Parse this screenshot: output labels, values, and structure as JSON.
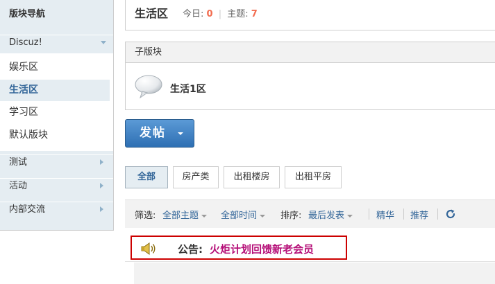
{
  "sidebar": {
    "title": "版块导航",
    "groups": [
      {
        "label": "Discuz!",
        "arrow": "down"
      },
      {
        "label": "测试",
        "arrow": "right"
      },
      {
        "label": "活动",
        "arrow": "right"
      },
      {
        "label": "内部交流",
        "arrow": "right"
      }
    ],
    "forums": [
      {
        "label": "娱乐区",
        "active": false
      },
      {
        "label": "生活区",
        "active": true
      },
      {
        "label": "学习区",
        "active": false
      },
      {
        "label": "默认版块",
        "active": false
      }
    ]
  },
  "header": {
    "title": "生活区",
    "today_label": "今日:",
    "today_count": "0",
    "separator": "|",
    "threads_label": "主题:",
    "threads_count": "7"
  },
  "subforums": {
    "heading": "子版块",
    "items": [
      {
        "name": "生活1区",
        "icon": "speech-bubble-icon"
      }
    ]
  },
  "post_button": {
    "label": "发帖"
  },
  "type_tabs": [
    {
      "label": "全部",
      "active": true
    },
    {
      "label": "房产类",
      "active": false
    },
    {
      "label": "出租楼房",
      "active": false
    },
    {
      "label": "出租平房",
      "active": false
    }
  ],
  "filter": {
    "label": "筛选:",
    "all_threads": "全部主题",
    "all_time": "全部时间",
    "sort_label": "排序:",
    "sort_value": "最后发表",
    "digest": "精华",
    "recommend": "推荐",
    "refresh_icon": "refresh-icon"
  },
  "announcement": {
    "label": "公告:",
    "text": "火炬计划回馈新老会员",
    "icon": "megaphone-icon"
  },
  "colors": {
    "accent": "#336699",
    "count": "#f26c4f",
    "announcement": "#b50f78",
    "highlight_border": "#cc0000",
    "sidebar_bg": "#e5edf2"
  }
}
